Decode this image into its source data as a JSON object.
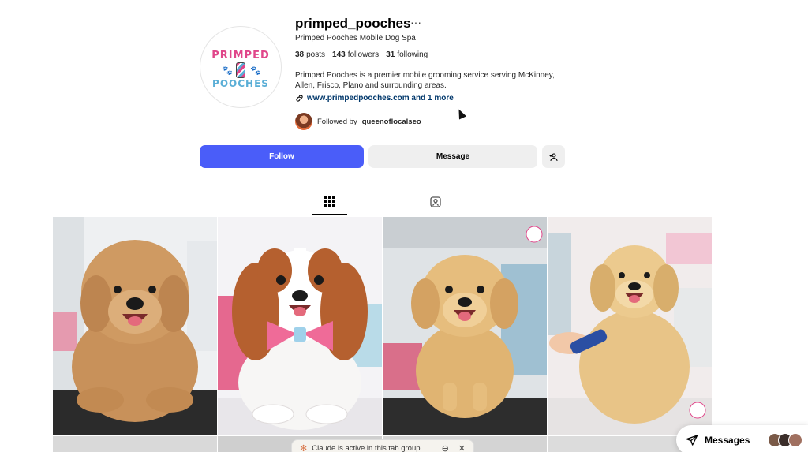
{
  "profile": {
    "username": "primped_pooches",
    "more_label": "···",
    "full_name": "Primped Pooches Mobile Dog Spa",
    "stats": [
      {
        "count": "38",
        "label": "posts"
      },
      {
        "count": "143",
        "label": "followers"
      },
      {
        "count": "31",
        "label": "following"
      }
    ],
    "bio": "Primped Pooches is a premier mobile grooming service serving McKinney, Allen, Frisco, Plano and surrounding areas.",
    "link_text": "www.primpedpooches.com and 1 more",
    "followed_by_prefix": "Followed by",
    "followed_by_user": "queenoflocalseo",
    "logo_top": "PRIMPED",
    "logo_bottom": "POOCHES"
  },
  "actions": {
    "follow_label": "Follow",
    "message_label": "Message"
  },
  "tabs": [
    {
      "name": "posts",
      "icon": "grid-icon",
      "active": true
    },
    {
      "name": "tagged",
      "icon": "tagged-icon",
      "active": false
    }
  ],
  "posts": [
    {
      "subject": "goldendoodle-puppy",
      "palette": "#c8915a"
    },
    {
      "subject": "cavalier-king-charles-with-pink-bow",
      "palette": "#b5602f"
    },
    {
      "subject": "golden-retriever-puppy",
      "palette": "#e0b472"
    },
    {
      "subject": "golden-retriever-being-brushed",
      "palette": "#e8c487"
    }
  ],
  "claude_banner": {
    "text": "Claude is active in this tab group"
  },
  "messages": {
    "label": "Messages"
  },
  "colors": {
    "follow_blue": "#4a5df9",
    "button_gray": "#efefef",
    "link_blue": "#00376b",
    "brand_pink": "#e0468a",
    "brand_blue": "#5aaed6"
  }
}
